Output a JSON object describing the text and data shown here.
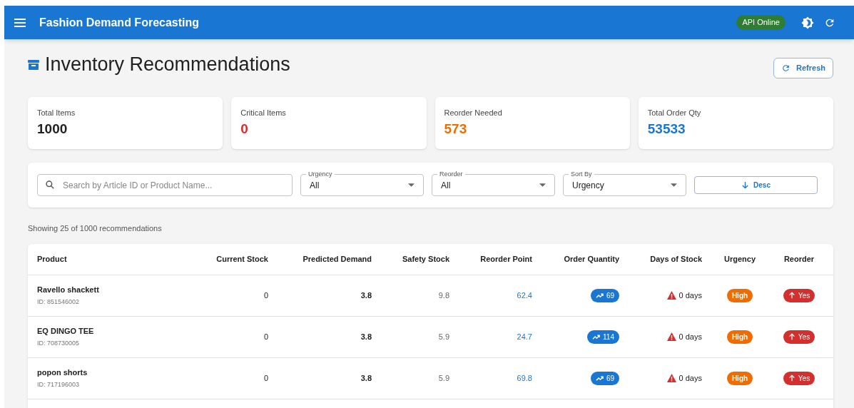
{
  "app_bar": {
    "title": "Fashion Demand Forecasting",
    "status_badge": "API Online"
  },
  "page": {
    "title": "Inventory Recommendations",
    "refresh_button": "Refresh"
  },
  "stats": [
    {
      "label": "Total Items",
      "value": "1000",
      "color": "#212121"
    },
    {
      "label": "Critical Items",
      "value": "0",
      "color": "#d32f2f"
    },
    {
      "label": "Reorder Needed",
      "value": "573",
      "color": "#ef6c00"
    },
    {
      "label": "Total Order Qty",
      "value": "53533",
      "color": "#1976d2"
    }
  ],
  "filters": {
    "search": {
      "placeholder": "Search by Article ID or Product Name..."
    },
    "selects": [
      {
        "label": "Urgency",
        "value": "All"
      },
      {
        "label": "Reorder",
        "value": "All"
      },
      {
        "label": "Sort By",
        "value": "Urgency"
      }
    ],
    "sort_button": "Desc"
  },
  "summary": "Showing 25 of 1000 recommendations",
  "table": {
    "columns": [
      "Product",
      "Current Stock",
      "Predicted Demand",
      "Safety Stock",
      "Reorder Point",
      "Order Quantity",
      "Days of Stock",
      "Urgency",
      "Reorder"
    ],
    "rows": [
      {
        "name": "Ravello shackett",
        "id": "ID: 851546002",
        "current_stock": "0",
        "predicted_demand": "3.8",
        "safety_stock": "9.8",
        "reorder_point": "62.4",
        "order_quantity": "69",
        "days_of_stock": "0 days",
        "warning": true,
        "urgency": {
          "label": "High",
          "color": "#ef6c00"
        },
        "reorder": {
          "label": "Yes",
          "needed": true
        }
      },
      {
        "name": "EQ DINGO TEE",
        "id": "ID: 708730005",
        "current_stock": "0",
        "predicted_demand": "3.8",
        "safety_stock": "5.9",
        "reorder_point": "24.7",
        "order_quantity": "114",
        "days_of_stock": "0 days",
        "warning": true,
        "urgency": {
          "label": "High",
          "color": "#ef6c00"
        },
        "reorder": {
          "label": "Yes",
          "needed": true
        }
      },
      {
        "name": "popon shorts",
        "id": "ID: 717196003",
        "current_stock": "0",
        "predicted_demand": "3.8",
        "safety_stock": "5.9",
        "reorder_point": "69.8",
        "order_quantity": "69",
        "days_of_stock": "0 days",
        "warning": true,
        "urgency": {
          "label": "High",
          "color": "#ef6c00"
        },
        "reorder": {
          "label": "Yes",
          "needed": true
        }
      }
    ]
  }
}
